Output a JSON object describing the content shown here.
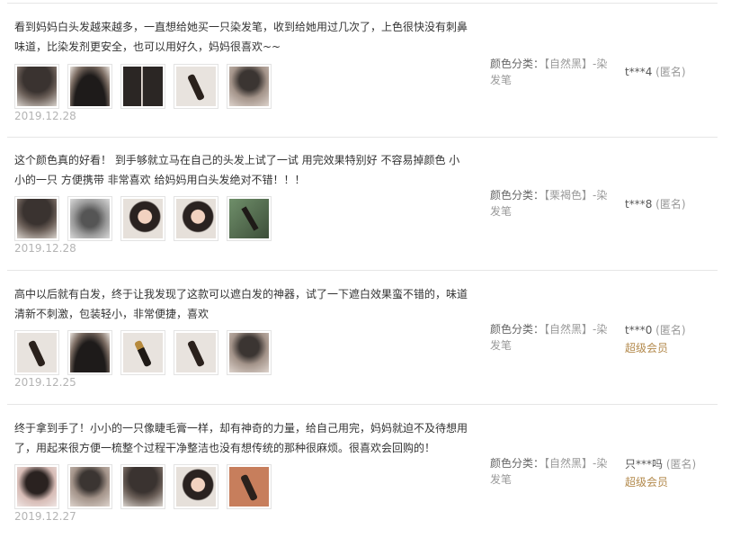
{
  "reviews": [
    {
      "text": "看到妈妈白头发越来越多，一直想给她买一只染发笔，收到给她用过几次了，上色很快没有刺鼻味道，比染发剂更安全，也可以用好久，妈妈很喜欢~~",
      "date": "2019.12.28",
      "sku_label": "颜色分类：",
      "sku_value": "【自然黑】-染发笔",
      "user": "t***4",
      "anon": "(匿名)",
      "vip": "",
      "photos": [
        "hair-dark",
        "hair-top",
        "hair-part",
        "pen",
        "crown"
      ]
    },
    {
      "text": "这个颜色真的好看！ 到手够就立马在自己的头发上试了一试 用完效果特别好 不容易掉颜色 小小的一只 方便携带 非常喜欢 给妈妈用白头发绝对不错！！！",
      "date": "2019.12.28",
      "sku_label": "颜色分类：",
      "sku_value": "【栗褐色】-染发笔",
      "user": "t***8",
      "anon": "(匿名)",
      "vip": "",
      "photos": [
        "hair-dark",
        "grey",
        "face",
        "face",
        "green"
      ]
    },
    {
      "text": "高中以后就有白发，终于让我发现了这款可以遮白发的神器，试了一下遮白效果蛮不错的，味道清新不刺激，包装轻小，非常便捷，喜欢",
      "date": "2019.12.25",
      "sku_label": "颜色分类：",
      "sku_value": "【自然黑】-染发笔",
      "user": "t***0",
      "anon": "(匿名)",
      "vip": "超级会员",
      "photos": [
        "pen",
        "hair-top",
        "pen gold",
        "pen",
        "crown"
      ]
    },
    {
      "text": "终于拿到手了！小小的一只像睫毛膏一样，却有神奇的力量，给自己用完，妈妈就迫不及待想用了，用起来很方便一梳整个过程干净整洁也没有想传统的那种很麻烦。很喜欢会回购的！",
      "date": "2019.12.27",
      "sku_label": "颜色分类：",
      "sku_value": "【自然黑】-染发笔",
      "user": "只***吗",
      "anon": "(匿名)",
      "vip": "超级会员",
      "photos": [
        "pink",
        "crown",
        "hair-dark",
        "face",
        "pen red"
      ]
    }
  ]
}
